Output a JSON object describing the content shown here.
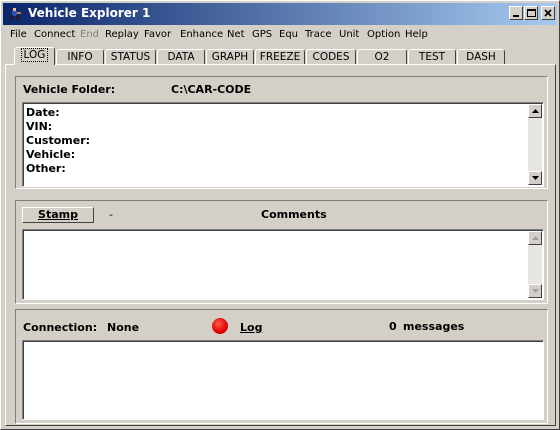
{
  "window": {
    "title": "Vehicle Explorer 1"
  },
  "menu": [
    "File",
    "Connect",
    "End",
    "Replay",
    "Favor",
    "Enhance",
    "Net",
    "GPS",
    "Equ",
    "Trace",
    "Unit",
    "Option",
    "Help"
  ],
  "tabs": [
    "LOG",
    "INFO",
    "STATUS",
    "DATA",
    "GRAPH",
    "FREEZE",
    "CODES",
    "O2",
    "TEST",
    "DASH"
  ],
  "active_tab": "LOG",
  "log": {
    "folder_label": "Vehicle Folder:",
    "folder_value": "C:\\CAR-CODE",
    "info_lines": [
      "Date:",
      "VIN:",
      "Customer:",
      "Vehicle:",
      "Other:"
    ],
    "stamp_label": "Stamp",
    "stamp_dash": "-",
    "comments_label": "Comments",
    "connection_label": "Connection:",
    "connection_value": "None",
    "log_label": "Log",
    "messages_count": "0",
    "messages_label": "messages"
  },
  "colors": {
    "title_start": "#0a246a",
    "title_end": "#a6caf0",
    "face": "#d4d0c8",
    "led": "#e00000"
  }
}
